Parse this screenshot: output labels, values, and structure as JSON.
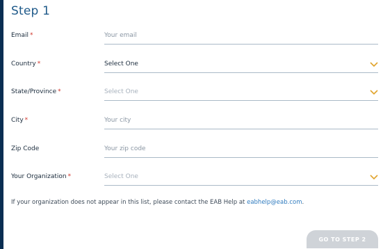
{
  "form": {
    "title": "Step 1",
    "fields": [
      {
        "label": "Email",
        "required": "*",
        "value": "Your email",
        "type": "input"
      },
      {
        "label": "Country",
        "required": "*",
        "value": "Select One",
        "type": "select"
      },
      {
        "label": "State/Province",
        "required": "*",
        "value": "Select One",
        "type": "select"
      },
      {
        "label": "City",
        "required": "*",
        "value": "Your city",
        "type": "input"
      },
      {
        "label": "Zip Code",
        "required": "",
        "value": "Your zip code",
        "type": "input"
      },
      {
        "label": "Your Organization",
        "required": "*",
        "value": "Select One",
        "type": "select"
      }
    ],
    "note_prefix": "If your organization does not appear in this list, please contact the EAB Help at ",
    "note_email": "eabhelp@eab.com",
    "note_suffix": ".",
    "next_button": "GO TO STEP 2"
  },
  "colors": {
    "accent": "#1f5a8a",
    "required": "#d0352b",
    "chevron": "#e0a32a",
    "link": "#2f7bbf",
    "button_disabled": "#cfd3d8"
  }
}
